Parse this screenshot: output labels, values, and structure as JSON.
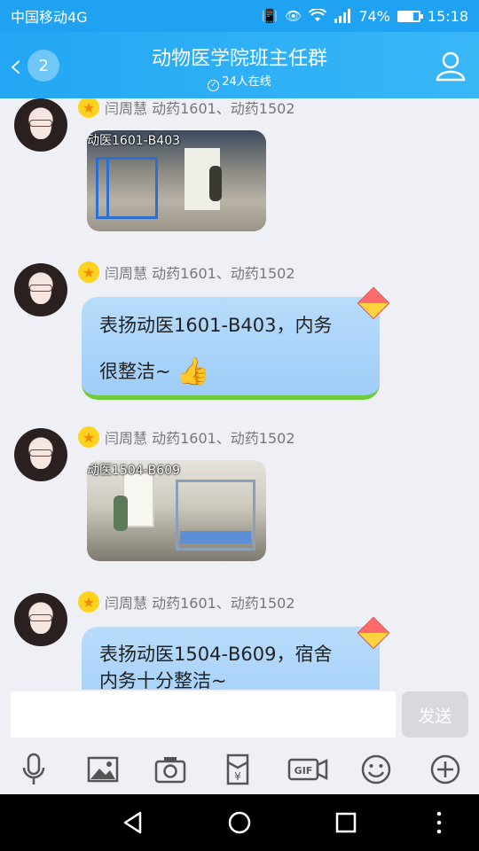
{
  "status_bar": {
    "carrier": "中国移动4G",
    "battery": "74%",
    "time": "15:18",
    "battery_level": 0.74
  },
  "header": {
    "back_badge": "2",
    "title": "动物医学院班主任群",
    "online": "24人在线"
  },
  "messages": [
    {
      "sender": "闫周慧 动药1601、动药1502",
      "type": "image",
      "caption": "动医1601-B403"
    },
    {
      "sender": "闫周慧 动药1601、动药1502",
      "type": "text",
      "line1": "表扬动医1601-B403，内务",
      "line2": "很整洁~"
    },
    {
      "sender": "闫周慧 动药1601、动药1502",
      "type": "image",
      "caption": "动医1504-B609"
    },
    {
      "sender": "闫周慧 动药1601、动药1502",
      "type": "text",
      "line1": "表扬动医1504-B609，宿舍",
      "line2": "内务十分整洁~"
    }
  ],
  "input": {
    "placeholder": "",
    "send_label": "发送"
  },
  "toolbar": {
    "icons": [
      "microphone-icon",
      "image-icon",
      "camera-icon",
      "red-packet-icon",
      "gif-icon",
      "emoji-icon",
      "plus-icon"
    ]
  },
  "colors": {
    "header_blue": "#23a7f4",
    "bubble_blue": "#a9d3fa",
    "background": "#eef0f5"
  }
}
